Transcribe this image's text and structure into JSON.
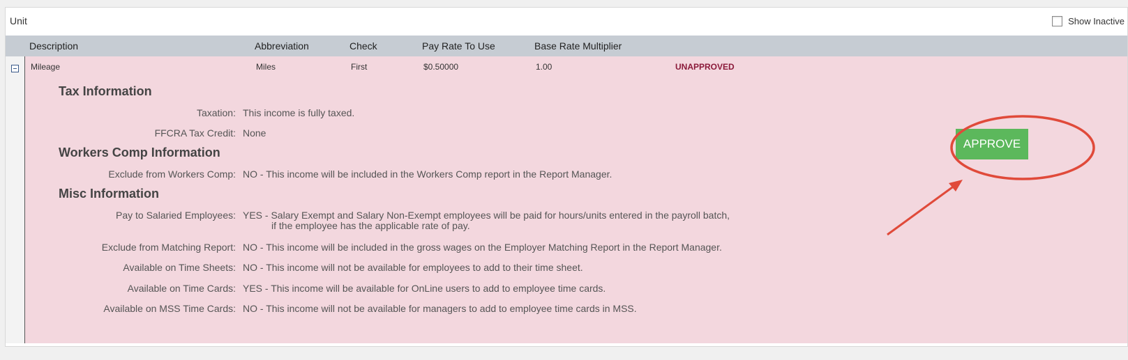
{
  "panel": {
    "title": "Unit",
    "show_inactive_label": "Show Inactive"
  },
  "columns": {
    "description": "Description",
    "abbreviation": "Abbreviation",
    "check": "Check",
    "pay_rate": "Pay Rate To Use",
    "multiplier": "Base Rate Multiplier"
  },
  "row": {
    "description": "Mileage",
    "abbreviation": "Miles",
    "check": "First",
    "pay_rate": "$0.50000",
    "multiplier": "1.00",
    "status": "UNAPPROVED"
  },
  "tax": {
    "title": "Tax Information",
    "taxation_label": "Taxation:",
    "taxation_value": "This income is fully taxed.",
    "ffcra_label": "FFCRA Tax Credit:",
    "ffcra_value": "None"
  },
  "workers_comp": {
    "title": "Workers Comp Information",
    "exclude_label": "Exclude from Workers Comp:",
    "exclude_value": "NO - This income will be included in the Workers Comp report in the Report Manager."
  },
  "misc": {
    "title": "Misc Information",
    "salaried_label": "Pay to Salaried Employees:",
    "salaried_value": "YES - Salary Exempt and Salary Non-Exempt employees will be paid for hours/units entered in the payroll batch,",
    "salaried_value_cont": "if the employee has the applicable rate of pay.",
    "matching_label": "Exclude from Matching Report:",
    "matching_value": "NO - This income will be included in the gross wages on the Employer Matching Report in the Report Manager.",
    "timesheets_label": "Available on Time Sheets:",
    "timesheets_value": "NO - This income will not be available for employees to add to their time sheet.",
    "timecards_label": "Available on Time Cards:",
    "timecards_value": "YES - This income will be available for OnLine users to add to employee time cards.",
    "mss_label": "Available on MSS Time Cards:",
    "mss_value": "NO - This income will not be available for managers to add to employee time cards in MSS."
  },
  "approve_label": "APPROVE",
  "colors": {
    "header_bg": "#c6ccd3",
    "row_bg": "#f3d7de",
    "approve_bg": "#5cb85c",
    "annotation": "#e04a3a"
  }
}
